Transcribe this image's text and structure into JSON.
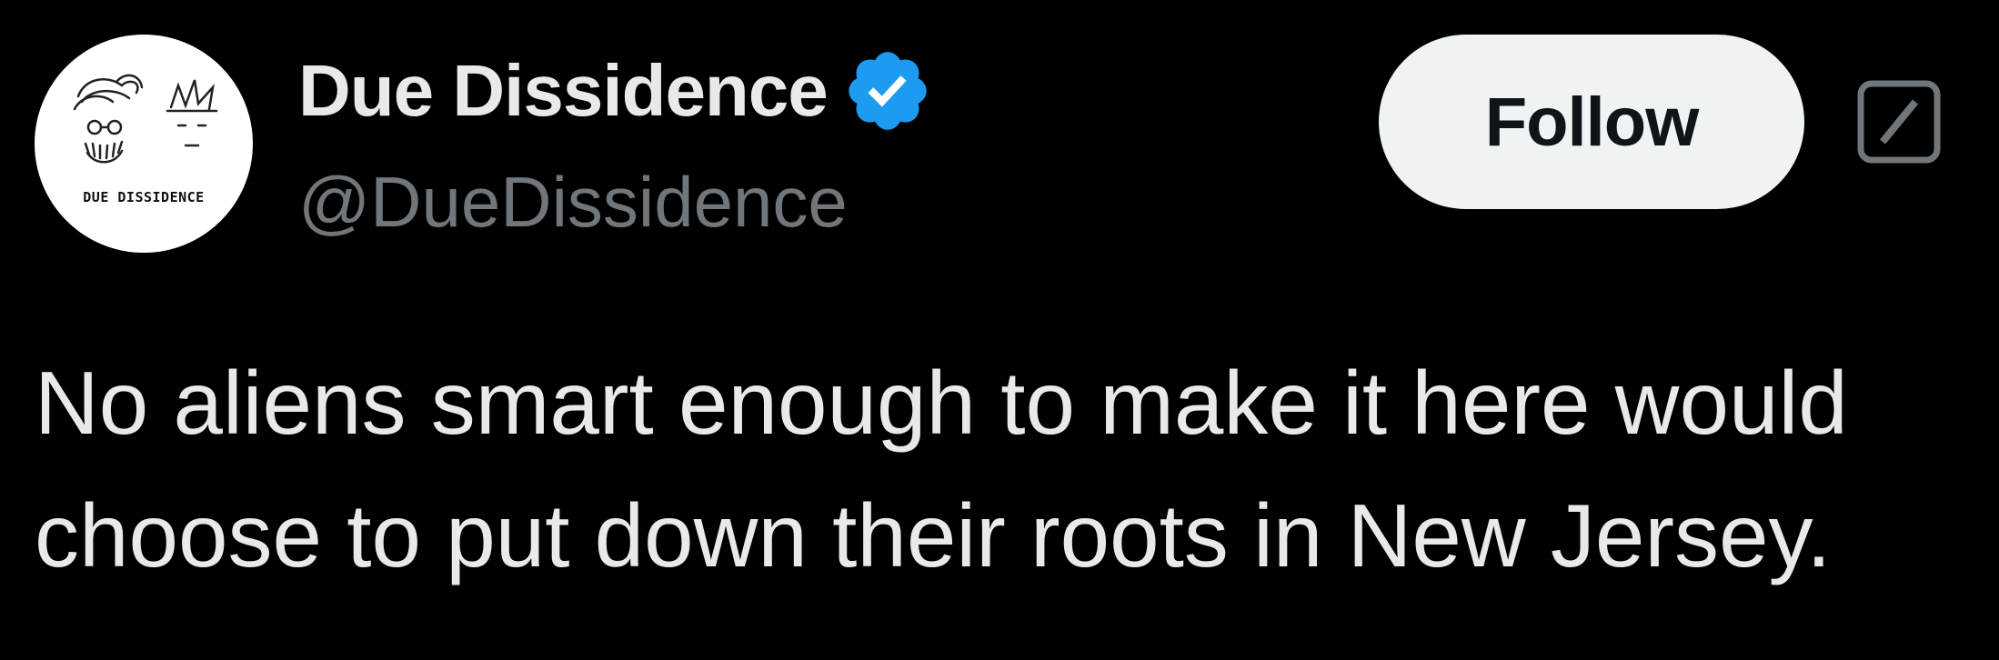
{
  "author": {
    "display_name": "Due Dissidence",
    "handle": "@DueDissidence",
    "verified": true,
    "verified_badge_icon": "verified-badge-icon",
    "verified_color": "#1d9bf0",
    "avatar_text": "DUE DISSIDENCE"
  },
  "actions": {
    "follow_label": "Follow",
    "grok_icon": "grok-icon"
  },
  "tweet": {
    "text": "No aliens smart enough to make it here would choose to put down their roots in New Jersey."
  },
  "colors": {
    "background": "#000000",
    "text_primary": "#e7e9ea",
    "text_secondary": "#71767b",
    "button_bg": "#eff3f4",
    "button_text": "#0f1419"
  }
}
